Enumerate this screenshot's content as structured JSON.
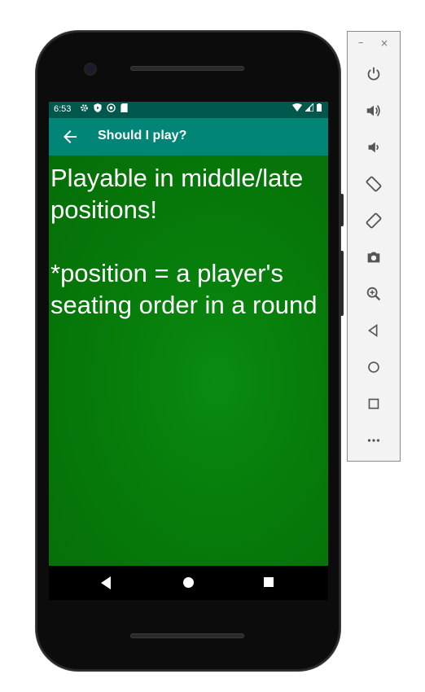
{
  "status_bar": {
    "time": "6:53"
  },
  "app_bar": {
    "title": "Should I play?"
  },
  "content": {
    "message": "Playable in middle/late positions!\n\n*position = a player's seating order in a round"
  },
  "toolbar": {
    "minimize_label": "–",
    "close_label": "×",
    "buttons": [
      "power-icon",
      "volume-up-icon",
      "volume-down-icon",
      "rotate-left-icon",
      "rotate-right-icon",
      "camera-icon",
      "zoom-icon",
      "back-icon",
      "home-icon",
      "overview-icon",
      "more-icon"
    ]
  },
  "colors": {
    "status_bar": "#00574b",
    "app_bar": "#008577",
    "felt": "#067a0a"
  }
}
